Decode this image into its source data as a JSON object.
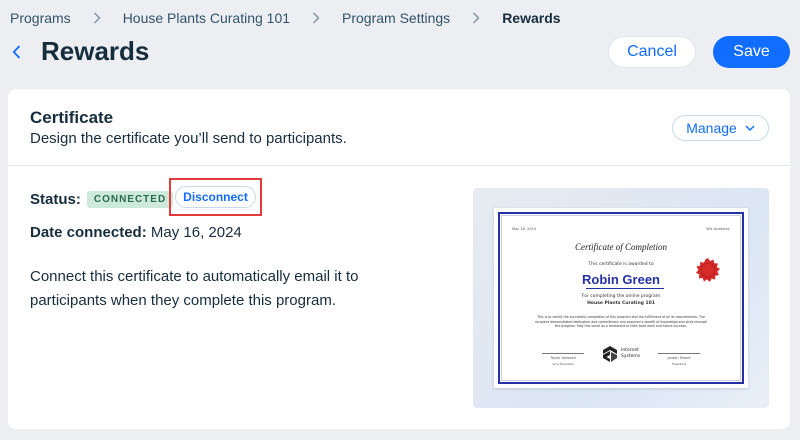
{
  "breadcrumb": {
    "items": [
      "Programs",
      "House Plants Curating 101",
      "Program Settings",
      "Rewards"
    ]
  },
  "header": {
    "title": "Rewards",
    "cancel_label": "Cancel",
    "save_label": "Save"
  },
  "card": {
    "title": "Certificate",
    "subtitle": "Design the certificate you’ll send to participants.",
    "manage_label": "Manage",
    "status_label": "Status:",
    "status_badge": "CONNECTED",
    "disconnect_label": "Disconnect",
    "date_label": "Date connected:",
    "date_value": "May 16, 2024",
    "description": "Connect this certificate to automatically email it to participants when they complete this program."
  },
  "certificate": {
    "date": "May 16, 2024",
    "org": "Wix Academy",
    "title": "Certificate of Completion",
    "awarded_to": "This certificate is awarded to",
    "recipient": "Robin Green",
    "for_completing": "For completing the online program",
    "program": "House Plants Curating 101",
    "body": "This is to certify the successful completion of this program and the fulfillment of all its requirements. The recipient demonstrated dedication and commitment and acquired a wealth of knowledge and skills through the program. May this serve as a testament to their hard work and future success.",
    "signer_left_name": "Taylor Areseed",
    "signer_left_role": "Vice President",
    "signer_right_name": "Jordan Moore",
    "signer_right_role": "President",
    "logo_text_line1": "Internet",
    "logo_text_line2": "Systems"
  },
  "colors": {
    "accent": "#116dff",
    "badge_bg": "#cde9dc",
    "badge_text": "#2b6b4e",
    "highlight": "#e23b3b",
    "cert_blue": "#2630a6",
    "seal_red": "#d42a2a"
  },
  "icons": {
    "back": "chevron-left-icon",
    "breadcrumb_sep": "chevron-right-icon",
    "manage_dropdown": "chevron-down-icon"
  }
}
